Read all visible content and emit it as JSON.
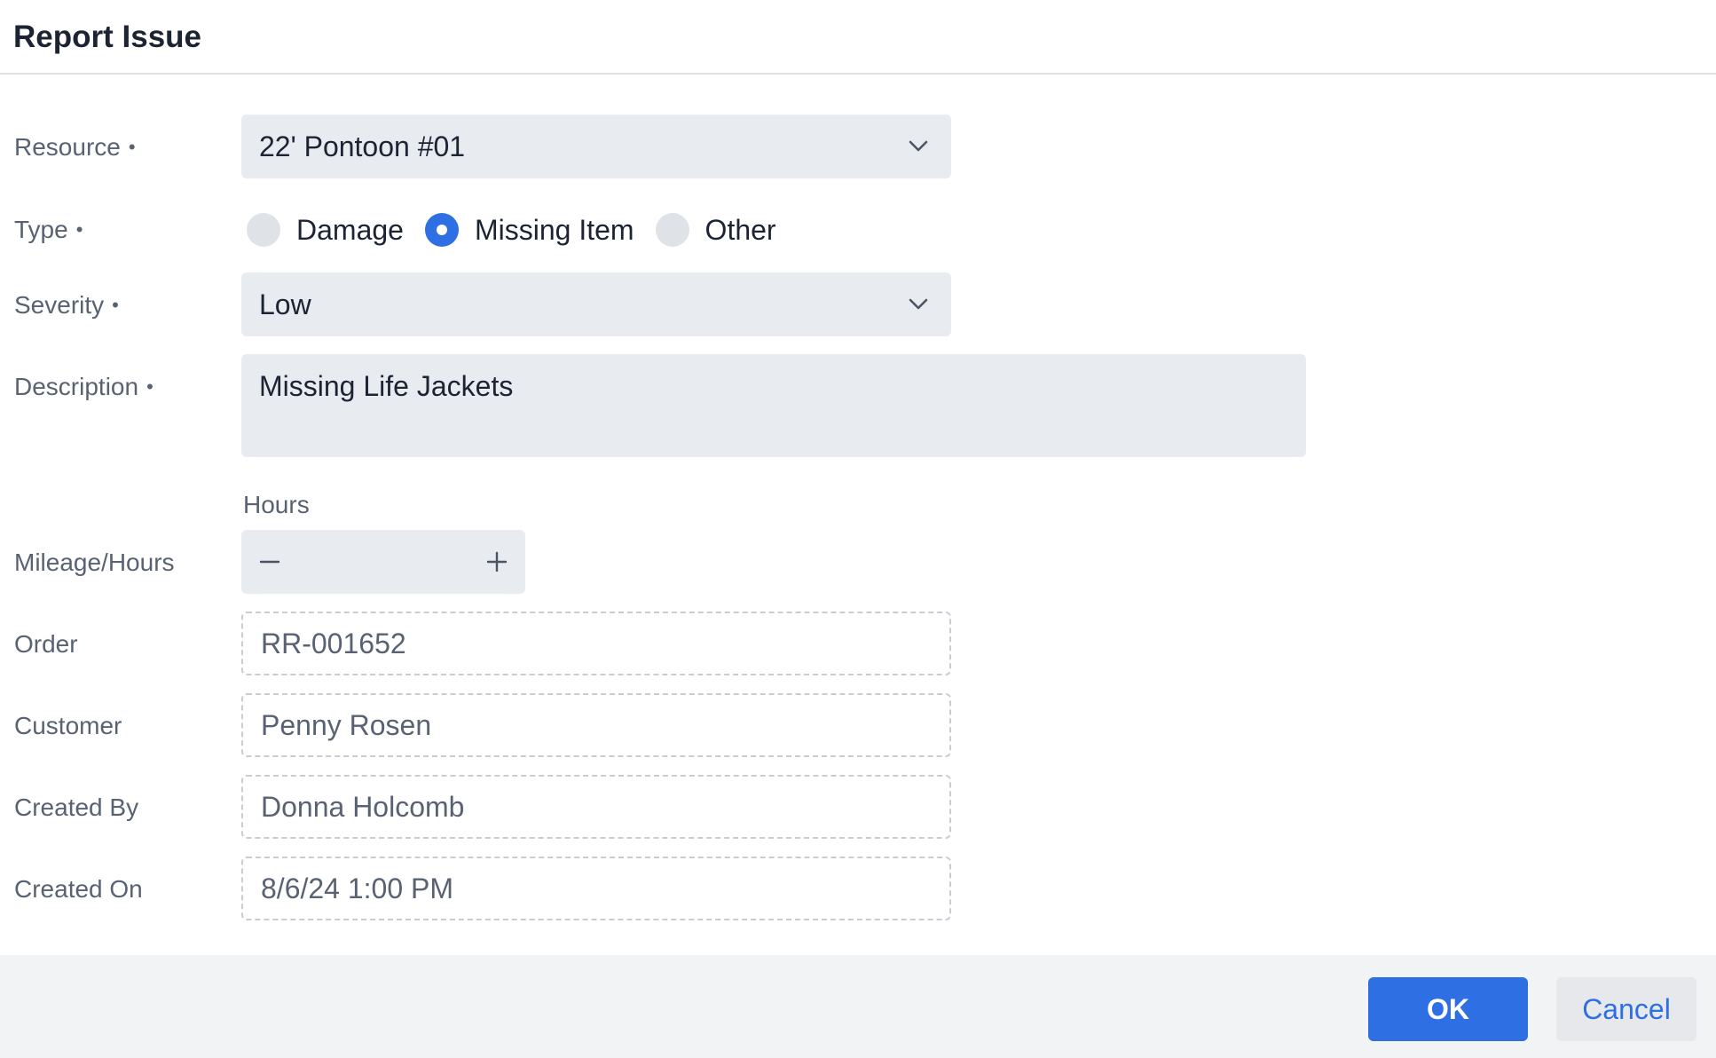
{
  "dialog": {
    "title": "Report Issue"
  },
  "fields": {
    "resource": {
      "label": "Resource",
      "required_mark": "•",
      "value": "22' Pontoon #01"
    },
    "type": {
      "label": "Type",
      "required_mark": "•",
      "options": [
        "Damage",
        "Missing Item",
        "Other"
      ],
      "selected": "Missing Item"
    },
    "severity": {
      "label": "Severity",
      "required_mark": "•",
      "value": "Low"
    },
    "description": {
      "label": "Description",
      "required_mark": "•",
      "value": "Missing Life Jackets"
    },
    "mileage": {
      "label": "Mileage/Hours",
      "unit_caption": "Hours",
      "value": ""
    },
    "order": {
      "label": "Order",
      "value": "RR-001652"
    },
    "customer": {
      "label": "Customer",
      "value": "Penny Rosen"
    },
    "created_by": {
      "label": "Created By",
      "value": "Donna Holcomb"
    },
    "created_on": {
      "label": "Created On",
      "value": "8/6/24 1:00 PM"
    }
  },
  "footer": {
    "ok_label": "OK",
    "cancel_label": "Cancel"
  },
  "icons": {
    "select_chevron": "chevron-down-icon",
    "stepper_minus": "minus-icon",
    "stepper_plus": "plus-icon"
  },
  "colors": {
    "accent": "#2f6fe4",
    "field_bg": "#e8ebef",
    "footer_bg": "#f2f3f5"
  }
}
